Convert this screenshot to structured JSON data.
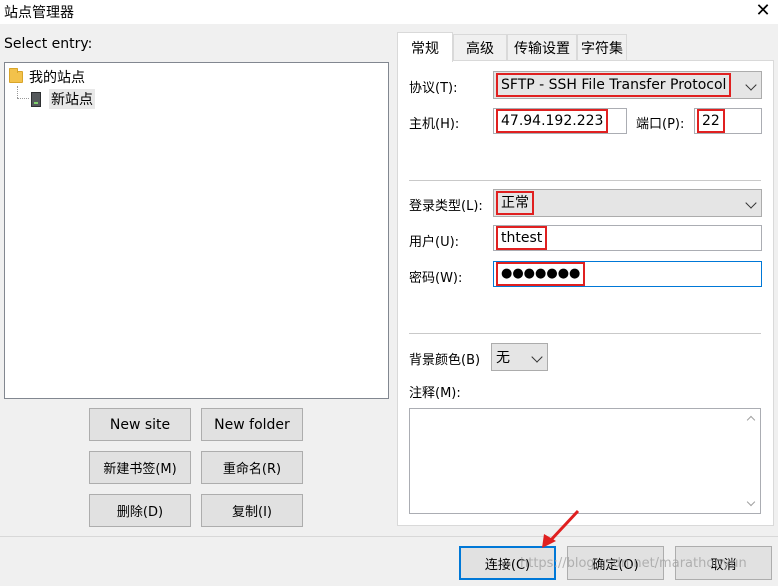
{
  "window": {
    "title": "站点管理器",
    "close_glyph": "✕"
  },
  "left": {
    "select_label": "Select entry:",
    "tree": [
      {
        "label": "我的站点",
        "icon": "folder-icon"
      },
      {
        "label": "新站点",
        "icon": "server-icon"
      }
    ],
    "buttons": {
      "new_site": "New site",
      "new_folder": "New folder",
      "new_bookmark": "新建书签(M)",
      "rename": "重命名(R)",
      "delete": "删除(D)",
      "copy": "复制(I)"
    }
  },
  "tabs": [
    "常规",
    "高级",
    "传输设置",
    "字符集"
  ],
  "general": {
    "protocol_label": "协议(T):",
    "protocol_value": "SFTP - SSH File Transfer Protocol",
    "host_label": "主机(H):",
    "host_value": "47.94.192.223",
    "port_label": "端口(P):",
    "port_value": "22",
    "logon_label": "登录类型(L):",
    "logon_value": "正常",
    "user_label": "用户(U):",
    "user_value": "thtest",
    "password_label": "密码(W):",
    "password_value": "●●●●●●●",
    "bgcolor_label": "背景颜色(B)",
    "bgcolor_value": "无",
    "comments_label": "注释(M):"
  },
  "footer": {
    "connect": "连接(C)",
    "ok": "确定(O)",
    "cancel": "取消",
    "watermark": "https://blog.csdn.net/marathonyun"
  },
  "colors": {
    "highlight_red": "#e02020",
    "focus_blue": "#0078d7"
  }
}
